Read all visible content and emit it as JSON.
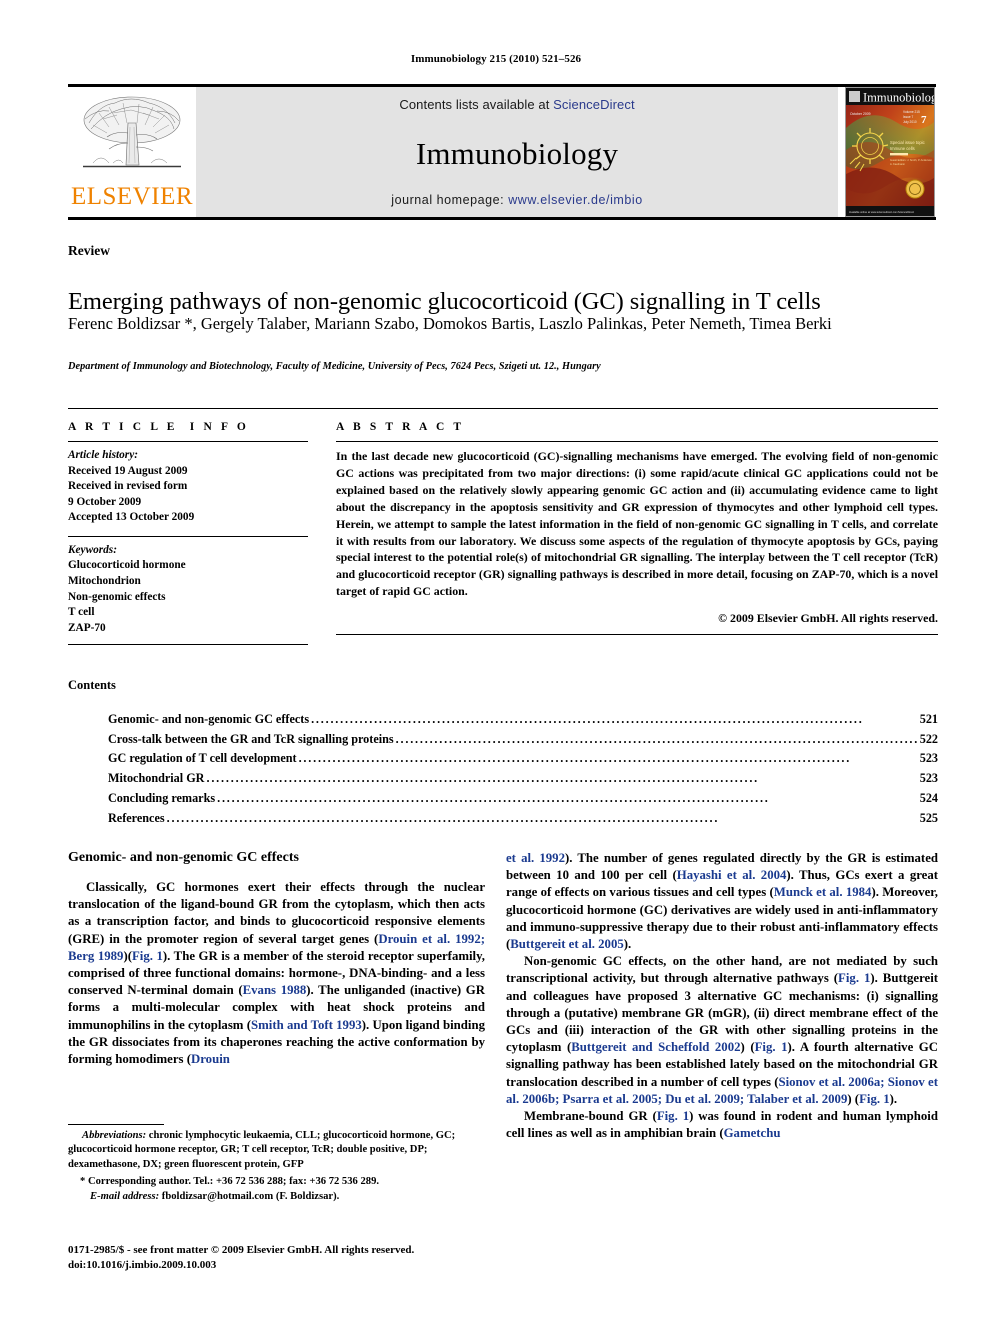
{
  "running_head": "Immunobiology 215 (2010) 521–526",
  "masthead": {
    "publisher_wordmark": "ELSEVIER",
    "contents_prefix": "Contents lists available at ",
    "sciencedirect": "ScienceDirect",
    "journal_name": "Immunobiology",
    "homepage_prefix": "journal homepage: ",
    "homepage_url": "www.elsevier.de/imbio",
    "cover_title": "Immunobiology",
    "cover_issue_number": "7",
    "link_color": "#2a3a8c",
    "elsevier_orange": "#ef8200"
  },
  "article": {
    "type": "Review",
    "title": "Emerging pathways of non-genomic glucocorticoid (GC) signalling in T cells",
    "authors": "Ferenc Boldizsar *, Gergely Talaber, Mariann Szabo, Domokos Bartis, Laszlo Palinkas, Peter Nemeth, Timea Berki",
    "affiliation": "Department of Immunology and Biotechnology, Faculty of Medicine, University of Pecs, 7624 Pecs, Szigeti ut. 12., Hungary"
  },
  "article_info": {
    "heading": "ARTICLE INFO",
    "history_label": "Article history:",
    "history_lines": [
      "Received 19 August 2009",
      "Received in revised form",
      "9 October 2009",
      "Accepted 13 October 2009"
    ],
    "keywords_label": "Keywords:",
    "keywords": [
      "Glucocorticoid hormone",
      "Mitochondrion",
      "Non-genomic effects",
      "T cell",
      "ZAP-70"
    ]
  },
  "abstract": {
    "heading": "ABSTRACT",
    "text": "In the last decade new glucocorticoid (GC)-signalling mechanisms have emerged. The evolving field of non-genomic GC actions was precipitated from two major directions: (i) some rapid/acute clinical GC applications could not be explained based on the relatively slowly appearing genomic GC action and (ii) accumulating evidence came to light about the discrepancy in the apoptosis sensitivity and GR expression of thymocytes and other lymphoid cell types. Herein, we attempt to sample the latest information in the field of non-genomic GC signalling in T cells, and correlate it with results from our laboratory. We discuss some aspects of the regulation of thymocyte apoptosis by GCs, paying special interest to the potential role(s) of mitochondrial GR signalling. The interplay between the T cell receptor (TcR) and glucocorticoid receptor (GR) signalling pathways is described in more detail, focusing on ZAP-70, which is a novel target of rapid GC action.",
    "copyright": "© 2009 Elsevier GmbH. All rights reserved."
  },
  "contents": {
    "heading": "Contents",
    "items": [
      {
        "label": "Genomic- and non-genomic GC effects",
        "page": "521"
      },
      {
        "label": "Cross-talk between the GR and TcR signalling proteins",
        "page": "522"
      },
      {
        "label": "GC regulation of T cell development",
        "page": "523"
      },
      {
        "label": "Mitochondrial GR",
        "page": "523"
      },
      {
        "label": "Concluding remarks",
        "page": "524"
      },
      {
        "label": "References",
        "page": "525"
      }
    ]
  },
  "body": {
    "section_heading": "Genomic- and non-genomic GC effects",
    "left_paragraph_1": {
      "seg1": "Classically, GC hormones exert their effects through the nuclear translocation of the ligand-bound GR from the cytoplasm, which then acts as a transcription factor, and binds to glucocorticoid responsive elements (GRE) in the promoter region of several target genes (",
      "cite1": "Drouin et al. 1992; Berg 1989",
      "seg2": ")(",
      "cite2": "Fig. 1",
      "seg3": "). The GR is a member of the steroid receptor superfamily, comprised of three functional domains: hormone-, DNA-binding- and a less conserved N-terminal domain (",
      "cite3": "Evans 1988",
      "seg4": "). The unliganded (inactive) GR forms a multi-molecular complex with heat shock proteins and immunophilins in the cytoplasm (",
      "cite4": "Smith and Toft 1993",
      "seg5": "). Upon ligand binding the GR dissociates from its chaperones reaching the active conformation by forming homodimers (",
      "cite5": "Drouin"
    },
    "right_paragraph_1": {
      "cite0": "et al. 1992",
      "seg1": "). The number of genes regulated directly by the GR is estimated between 10 and 100 per cell (",
      "cite1": "Hayashi et al. 2004",
      "seg2": "). Thus, GCs exert a great range of effects on various tissues and cell types (",
      "cite2": "Munck et al. 1984",
      "seg3": "). Moreover, glucocorticoid hormone (GC) derivatives are widely used in anti-inflammatory and immuno-suppressive therapy due to their robust anti-inflammatory effects (",
      "cite3": "Buttgereit et al. 2005",
      "seg4": ")."
    },
    "right_paragraph_2": {
      "seg1": "Non-genomic GC effects, on the other hand, are not mediated by such transcriptional activity, but through alternative pathways (",
      "cite1": "Fig. 1",
      "seg2": "). Buttgereit and colleagues have proposed 3 alternative GC mechanisms: (i) signalling through a (putative) membrane GR (mGR), (ii) direct membrane effect of the GCs and (iii) interaction of the GR with other signalling proteins in the cytoplasm (",
      "cite2": "Buttgereit and Scheffold 2002",
      "seg3": ") (",
      "cite3": "Fig. 1",
      "seg4": "). A fourth alternative GC signalling pathway has been established lately based on the mitochondrial GR translocation described in a number of cell types (",
      "cite4": "Sionov et al. 2006a; Sionov et al. 2006b; Psarra et al. 2005; Du et al. 2009; Talaber et al. 2009",
      "seg5": ") (",
      "cite5": "Fig. 1",
      "seg6": ")."
    },
    "right_paragraph_3": {
      "seg1": "Membrane-bound GR (",
      "cite1": "Fig. 1",
      "seg2": ") was found in rodent and human lymphoid cell lines as well as in amphibian brain (",
      "cite2": "Gametchu"
    }
  },
  "footnotes": {
    "abbreviations_label": "Abbreviations:",
    "abbreviations_text": " chronic lymphocytic leukaemia, CLL; glucocorticoid hormone, GC; glucocorticoid hormone receptor, GR; T cell receptor, TcR; double positive, DP; dexamethasone, DX; green fluorescent protein, GFP",
    "corresponding": "* Corresponding author. Tel.: +36 72 536 288; fax: +36 72 536 289.",
    "email_label": "E-mail address:",
    "email_text": " fboldizsar@hotmail.com (F. Boldizsar).",
    "issn_line": "0171-2985/$ - see front matter © 2009 Elsevier GmbH. All rights reserved.",
    "doi_line": "doi:10.1016/j.imbio.2009.10.003"
  }
}
